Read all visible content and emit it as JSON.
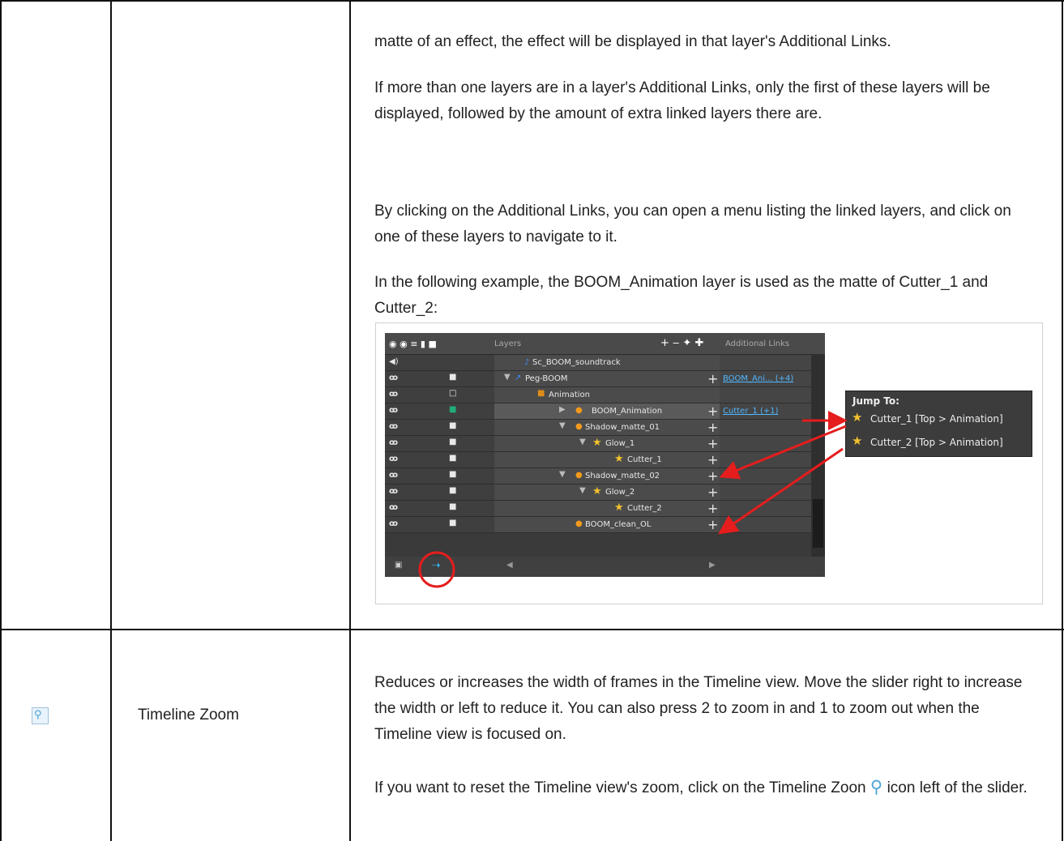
{
  "paragraphs": {
    "p1": "matte of an effect, the effect will be displayed in that layer's Additional Links.",
    "p2": "If more than one layers are in a layer's Additional Links, only the first of these layers will be displayed, followed by the amount of extra linked layers there are.",
    "p3": "By clicking on the Additional Links, you can open a menu listing the linked layers, and click on one of these layers to navigate to it.",
    "p4": "In the following example, the BOOM_Animation layer is used as the matte of Cutter_1 and Cutter_2:",
    "zoom_desc": "Reduces or increases the width of frames in the Timeline view. Move the slider right to increase the width or left to reduce it. You can also press 2 to zoom in and 1 to zoom out when the Timeline view is focused on.",
    "zoom_reset_before": "If you want to reset the Timeline view's zoom, click on the Timeline Zoon",
    "zoom_reset_after": "icon left of the slider."
  },
  "row_label": "Timeline Zoom",
  "screenshot": {
    "header_layers": "Layers",
    "header_links": "Additional Links",
    "rows": [
      {
        "name": "Sc_BOOM_soundtrack",
        "link": ""
      },
      {
        "name": "Peg-BOOM",
        "link": "BOOM_Ani... (+4)"
      },
      {
        "name": "Animation",
        "link": ""
      },
      {
        "name": "BOOM_Animation",
        "link": "Cutter_1 (+1)"
      },
      {
        "name": "Shadow_matte_01",
        "link": ""
      },
      {
        "name": "Glow_1",
        "link": ""
      },
      {
        "name": "Cutter_1",
        "link": ""
      },
      {
        "name": "Shadow_matte_02",
        "link": ""
      },
      {
        "name": "Glow_2",
        "link": ""
      },
      {
        "name": "Cutter_2",
        "link": ""
      },
      {
        "name": "BOOM_clean_OL",
        "link": ""
      }
    ],
    "popup_title": "Jump To:",
    "popup_items": [
      "Cutter_1 [Top > Animation]",
      "Cutter_2 [Top > Animation]"
    ]
  },
  "colors": {
    "accent_red": "#e51d1d",
    "star_yellow": "#f2c12e",
    "link_blue": "#4fb7ff"
  }
}
